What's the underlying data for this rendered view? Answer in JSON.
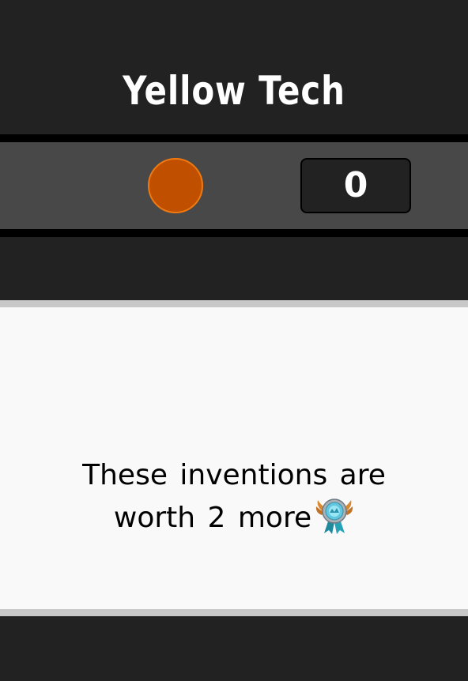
{
  "header": {
    "title": "Yellow Tech"
  },
  "status_bar": {
    "token_color": "#c05000",
    "counter_value": "0"
  },
  "card": {
    "message_line1": "These inventions are",
    "message_line2": "worth 2 more",
    "icon": "medal-icon"
  }
}
